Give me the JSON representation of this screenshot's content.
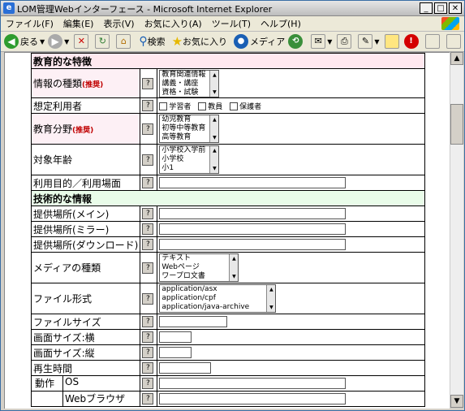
{
  "window": {
    "title": "LOM管理Webインターフェース - Microsoft Internet Explorer",
    "min": "_",
    "max": "□",
    "close": "✕"
  },
  "menu": [
    "ファイル(F)",
    "編集(E)",
    "表示(V)",
    "お気に入り(A)",
    "ツール(T)",
    "ヘルプ(H)"
  ],
  "toolbar": {
    "back": "戻る",
    "search": "検索",
    "favorites": "お気に入り",
    "media": "メディア"
  },
  "form": {
    "help_label": "?",
    "section_edu": "教育的な特徴",
    "info_type": {
      "label": "情報の種類",
      "badge": "(推奨)",
      "options": [
        "教育関連情報",
        "講義・講座",
        "資格・試験"
      ]
    },
    "intended_user": {
      "label": "想定利用者",
      "options": [
        "学習者",
        "教員",
        "保護者"
      ]
    },
    "edu_field": {
      "label": "教育分野",
      "badge": "(推奨)",
      "options": [
        "幼児教育",
        "初等中等教育",
        "高等教育"
      ]
    },
    "target_age": {
      "label": "対象年齢",
      "options": [
        "小学校入学前",
        "小学校",
        "小1"
      ]
    },
    "purpose": {
      "label": "利用目的／利用場面"
    },
    "section_tech": "技術的な情報",
    "loc_main": "提供場所(メイン)",
    "loc_mirror": "提供場所(ミラー)",
    "loc_download": "提供場所(ダウンロード)",
    "media_type": {
      "label": "メディアの種類",
      "options": [
        "テキスト",
        "Webページ",
        "ワープロ文書"
      ]
    },
    "file_format": {
      "label": "ファイル形式",
      "options": [
        "application/asx",
        "application/cpf",
        "application/java-archive"
      ]
    },
    "file_size": "ファイルサイズ",
    "screen_w": "画面サイズ:横",
    "screen_h": "画面サイズ:縦",
    "play_time": "再生時間",
    "env_group": "動作",
    "os": "OS",
    "browser": "Webブラウザ"
  }
}
